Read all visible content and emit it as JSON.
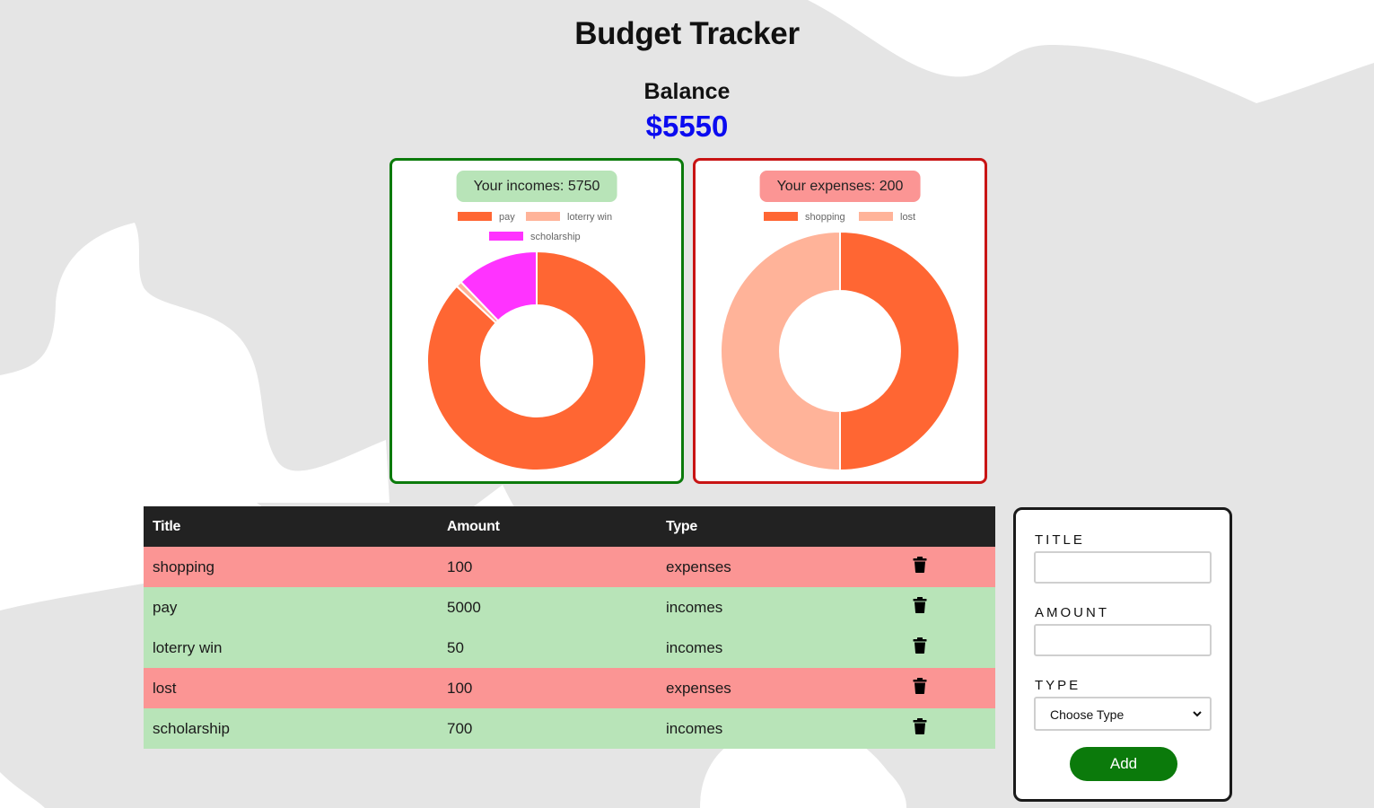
{
  "app": {
    "title": "Budget Tracker"
  },
  "balance": {
    "label": "Balance",
    "value": "$5550"
  },
  "colors": {
    "background": "#e5e5e5",
    "balance_value": "#0b0bf0",
    "incomes_border": "#0b7a0b",
    "incomes_pill": "#b8e4b8",
    "expenses_border": "#c81414",
    "expenses_pill": "#fb9594",
    "row_expenses": "#fb9594",
    "row_incomes": "#b8e4b8",
    "table_header": "#222222",
    "add_button": "#0b7a0b"
  },
  "incomes_card": {
    "pill": "Your incomes: 5750"
  },
  "expenses_card": {
    "pill": "Your expenses: 200"
  },
  "chart_data": [
    {
      "type": "pie",
      "variant": "doughnut",
      "title": "Your incomes: 5750",
      "legend_position": "top",
      "labels": [
        "pay",
        "loterry win",
        "scholarship"
      ],
      "values": [
        5000,
        50,
        700
      ],
      "colors": [
        "#ff6633",
        "#ffb399",
        "#ff33ff"
      ]
    },
    {
      "type": "pie",
      "variant": "doughnut",
      "title": "Your expenses: 200",
      "legend_position": "top",
      "labels": [
        "shopping",
        "lost"
      ],
      "values": [
        100,
        100
      ],
      "colors": [
        "#ff6633",
        "#ffb399"
      ]
    }
  ],
  "table": {
    "headers": {
      "title": "Title",
      "amount": "Amount",
      "type": "Type"
    },
    "rows": [
      {
        "title": "shopping",
        "amount": "100",
        "type": "expenses",
        "icon": "trash-icon"
      },
      {
        "title": "pay",
        "amount": "5000",
        "type": "incomes",
        "icon": "trash-icon"
      },
      {
        "title": "loterry win",
        "amount": "50",
        "type": "incomes",
        "icon": "trash-icon"
      },
      {
        "title": "lost",
        "amount": "100",
        "type": "expenses",
        "icon": "trash-icon"
      },
      {
        "title": "scholarship",
        "amount": "700",
        "type": "incomes",
        "icon": "trash-icon"
      }
    ]
  },
  "form": {
    "title_label": "TITLE",
    "title_value": "",
    "amount_label": "AMOUNT",
    "amount_value": "",
    "type_label": "TYPE",
    "type_selected": "Choose Type",
    "add_label": "Add"
  }
}
